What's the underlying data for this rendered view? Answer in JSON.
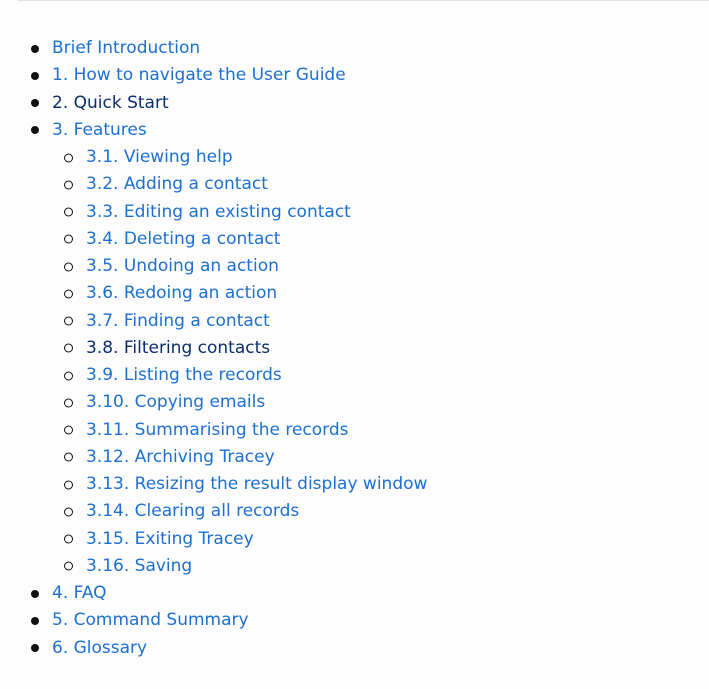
{
  "toc": {
    "items": [
      {
        "label": "Brief Introduction"
      },
      {
        "label": "1. How to navigate the User Guide"
      },
      {
        "label": "2. Quick Start"
      },
      {
        "label": "3. Features",
        "children": [
          {
            "label": "3.1. Viewing help"
          },
          {
            "label": "3.2. Adding a contact"
          },
          {
            "label": "3.3. Editing an existing contact"
          },
          {
            "label": "3.4. Deleting a contact"
          },
          {
            "label": "3.5. Undoing an action"
          },
          {
            "label": "3.6. Redoing an action"
          },
          {
            "label": "3.7. Finding a contact"
          },
          {
            "label": "3.8. Filtering contacts"
          },
          {
            "label": "3.9. Listing the records"
          },
          {
            "label": "3.10. Copying emails"
          },
          {
            "label": "3.11. Summarising the records"
          },
          {
            "label": "3.12. Archiving Tracey"
          },
          {
            "label": "3.13. Resizing the result display window"
          },
          {
            "label": "3.14. Clearing all records"
          },
          {
            "label": "3.15. Exiting Tracey"
          },
          {
            "label": "3.16. Saving"
          }
        ]
      },
      {
        "label": "4. FAQ"
      },
      {
        "label": "5. Command Summary"
      },
      {
        "label": "6. Glossary"
      }
    ]
  },
  "colors": {
    "link": "#1d6fd0",
    "visited_link": "#0b2e6b",
    "bullet": "#111111",
    "background": "#fdfdfd"
  }
}
